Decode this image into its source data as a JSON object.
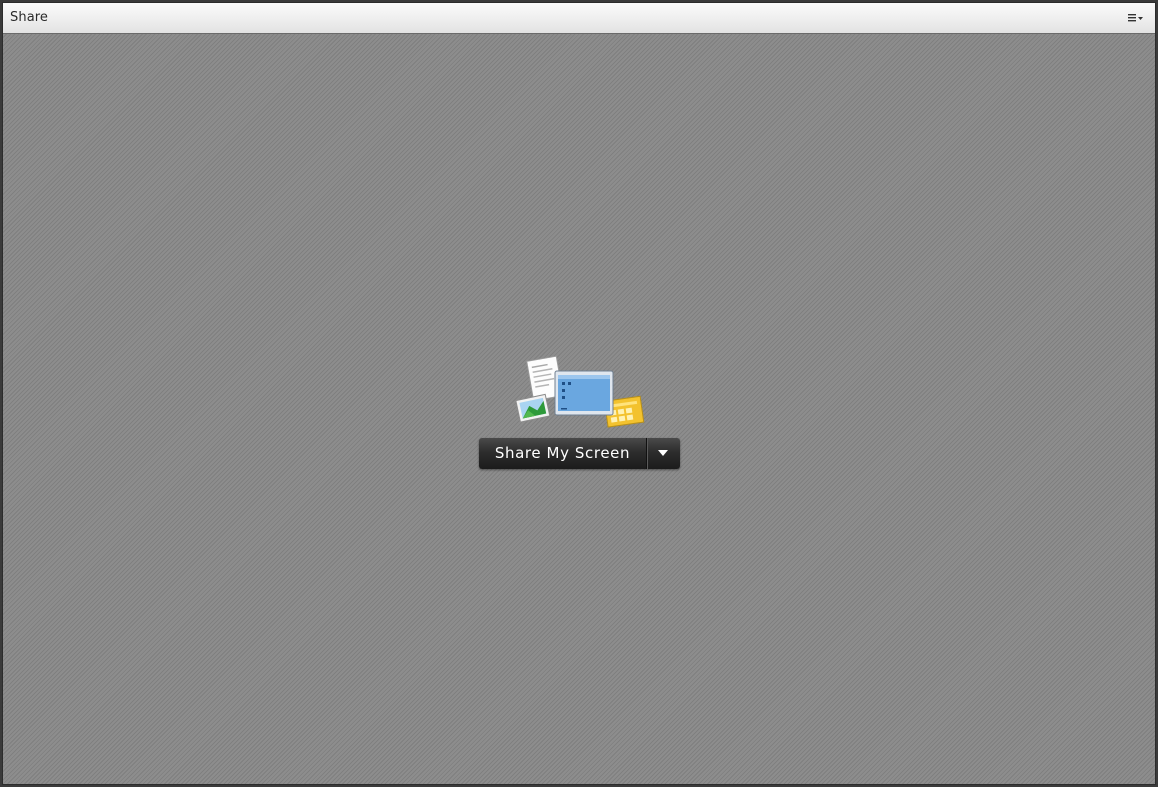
{
  "pod": {
    "title": "Share",
    "menu_icon": "pod-options-menu-icon"
  },
  "share": {
    "graphic_icon": "share-content-icon",
    "button_label": "Share My Screen",
    "dropdown_icon": "chevron-down-icon"
  },
  "colors": {
    "title_bar": "#eeeeee",
    "content_background": "#878787",
    "button": "#2d2d2d",
    "button_text": "#ffffff"
  }
}
